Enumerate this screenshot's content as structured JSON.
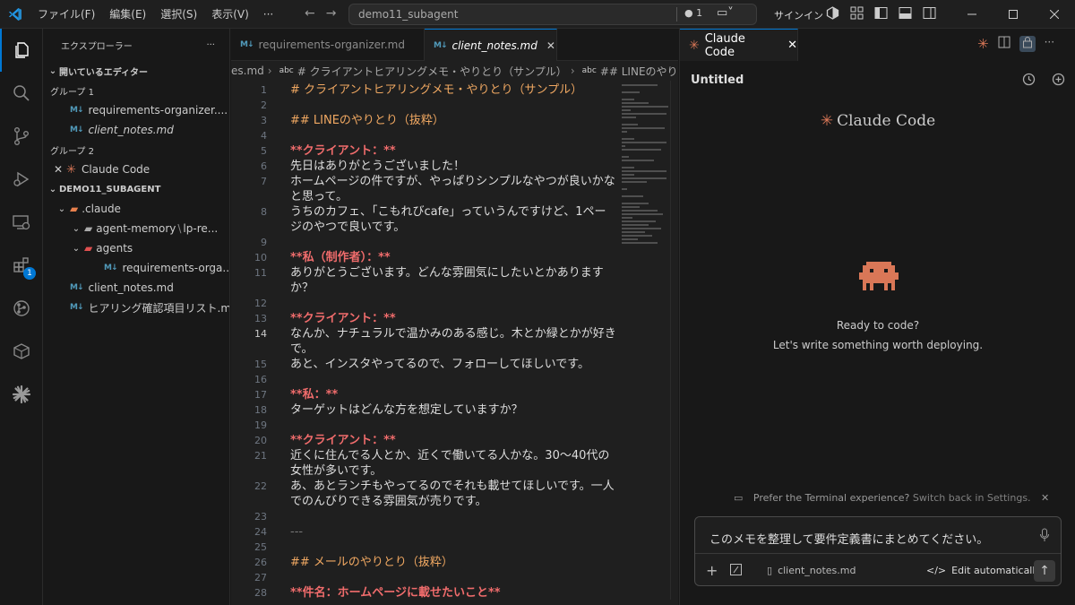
{
  "menu": [
    "ファイル(F)",
    "編集(E)",
    "選択(S)",
    "表示(V)",
    "···"
  ],
  "command_center": {
    "text": "demo11_subagent",
    "count": "1"
  },
  "titlebar": {
    "signin": "サインイン"
  },
  "colors": {
    "accent": "#0078d4",
    "claude": "#d97757",
    "heading": "#f0a862",
    "bold": "#f06c6c"
  },
  "sidebar": {
    "title": "エクスプローラー",
    "open_editors": "開いているエディター",
    "group1": "グループ 1",
    "group1_files": [
      "requirements-organizer....",
      "client_notes.md"
    ],
    "group2": "グループ 2",
    "group2_item": "Claude Code",
    "workspace": "DEMO11_SUBAGENT",
    "tree": {
      "claude_dir": ".claude",
      "agent_memory": "agent-memory",
      "agent_memory_sub": "lp-re...",
      "agents": "agents",
      "req_file": "requirements-orga...",
      "client_notes": "client_notes.md",
      "hearing": "ヒアリング確認項目リスト.md"
    }
  },
  "tabs": [
    {
      "label": "requirements-organizer.md"
    },
    {
      "label": "client_notes.md"
    }
  ],
  "breadcrumb": {
    "first": "es.md",
    "abc1": "abc",
    "h1": "# クライアントヒアリングメモ・やりとり（サンプル）",
    "abc2": "abc",
    "h2": "## LINEのやりとり（抜粋）"
  },
  "code_lines": [
    {
      "n": "1",
      "t": "# クライアントヒアリングメモ・やりとり（サンプル）"
    },
    {
      "n": "2",
      "t": ""
    },
    {
      "n": "3",
      "t": "## LINEのやりとり（抜粋）"
    },
    {
      "n": "4",
      "t": ""
    },
    {
      "n": "5",
      "t": "**クライアント：**"
    },
    {
      "n": "6",
      "t": "先日はありがとうございました！"
    },
    {
      "n": "7",
      "t": "ホームページの件ですが、やっぱりシンプルなやつが良いかな"
    },
    {
      "n": "",
      "t": "と思って。"
    },
    {
      "n": "8",
      "t": "うちのカフェ、「こもれびcafe」っていうんですけど、1ペー"
    },
    {
      "n": "",
      "t": "ジのやつで良いです。"
    },
    {
      "n": "9",
      "t": ""
    },
    {
      "n": "10",
      "t": "**私（制作者）：**"
    },
    {
      "n": "11",
      "t": "ありがとうございます。どんな雰囲気にしたいとかあります"
    },
    {
      "n": "",
      "t": "か？"
    },
    {
      "n": "12",
      "t": ""
    },
    {
      "n": "13",
      "t": "**クライアント：**"
    },
    {
      "n": "14",
      "t": "なんか、ナチュラルで温かみのある感じ。木とか緑とかが好き"
    },
    {
      "n": "",
      "t": "で。"
    },
    {
      "n": "15",
      "t": "あと、インスタやってるので、フォローしてほしいです。"
    },
    {
      "n": "16",
      "t": ""
    },
    {
      "n": "17",
      "t": "**私：**"
    },
    {
      "n": "18",
      "t": "ターゲットはどんな方を想定していますか？"
    },
    {
      "n": "19",
      "t": ""
    },
    {
      "n": "20",
      "t": "**クライアント：**"
    },
    {
      "n": "21",
      "t": "近くに住んでる人とか、近くで働いてる人かな。30〜40代の"
    },
    {
      "n": "",
      "t": "女性が多いです。"
    },
    {
      "n": "22",
      "t": "あ、あとランチもやってるのでそれも載せてほしいです。一人"
    },
    {
      "n": "",
      "t": "でのんびりできる雰囲気が売りです。"
    },
    {
      "n": "23",
      "t": ""
    },
    {
      "n": "24",
      "t": "---"
    },
    {
      "n": "25",
      "t": ""
    },
    {
      "n": "26",
      "t": "## メールのやりとり（抜粋）"
    },
    {
      "n": "27",
      "t": ""
    },
    {
      "n": "28",
      "t": "**件名：ホームページに載せたいこと**"
    }
  ],
  "panel": {
    "tab_label": "Claude Code",
    "title": "Untitled",
    "brand": "Claude Code",
    "ready1": "Ready to code?",
    "ready2": "Let's write something worth deploying.",
    "notice": "Prefer the Terminal experience?",
    "notice_link": "Switch back in Settings.",
    "input_text": "このメモを整理して要件定義書にまとめてください。",
    "file_chip": "client_notes.md",
    "edit_mode": "Edit automatically"
  }
}
